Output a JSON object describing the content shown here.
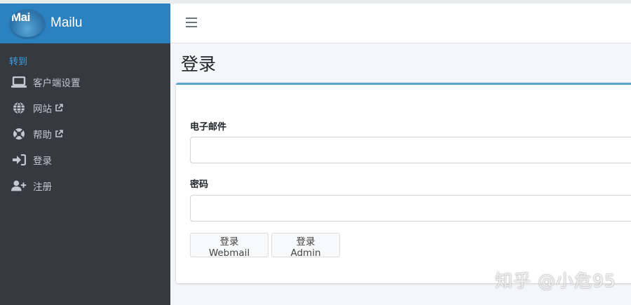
{
  "brand": {
    "logo_text": "Mai",
    "name": "Mailu"
  },
  "sidebar": {
    "section_header": "转到",
    "items": [
      {
        "label": "客户端设置",
        "icon": "laptop-icon"
      },
      {
        "label": "网站",
        "icon": "globe-icon",
        "external": true
      },
      {
        "label": "帮助",
        "icon": "life-ring-icon",
        "external": true
      },
      {
        "label": "登录",
        "icon": "sign-in-icon"
      },
      {
        "label": "注册",
        "icon": "user-plus-icon"
      }
    ]
  },
  "header": {
    "menu_icon": "hamburger-icon"
  },
  "main": {
    "page_title": "登录",
    "form": {
      "email_label": "电子邮件",
      "email_value": "",
      "password_label": "密码",
      "password_value": "",
      "webmail_button": "登录 Webmail",
      "admin_button": "登录 Admin"
    }
  },
  "watermark": "知乎 @小危95",
  "colors": {
    "sidebar_bg": "#343a40",
    "brand_bg": "#2c82c1",
    "accent": "#3f9fe0",
    "card_top_border": "#5ba4cf"
  }
}
